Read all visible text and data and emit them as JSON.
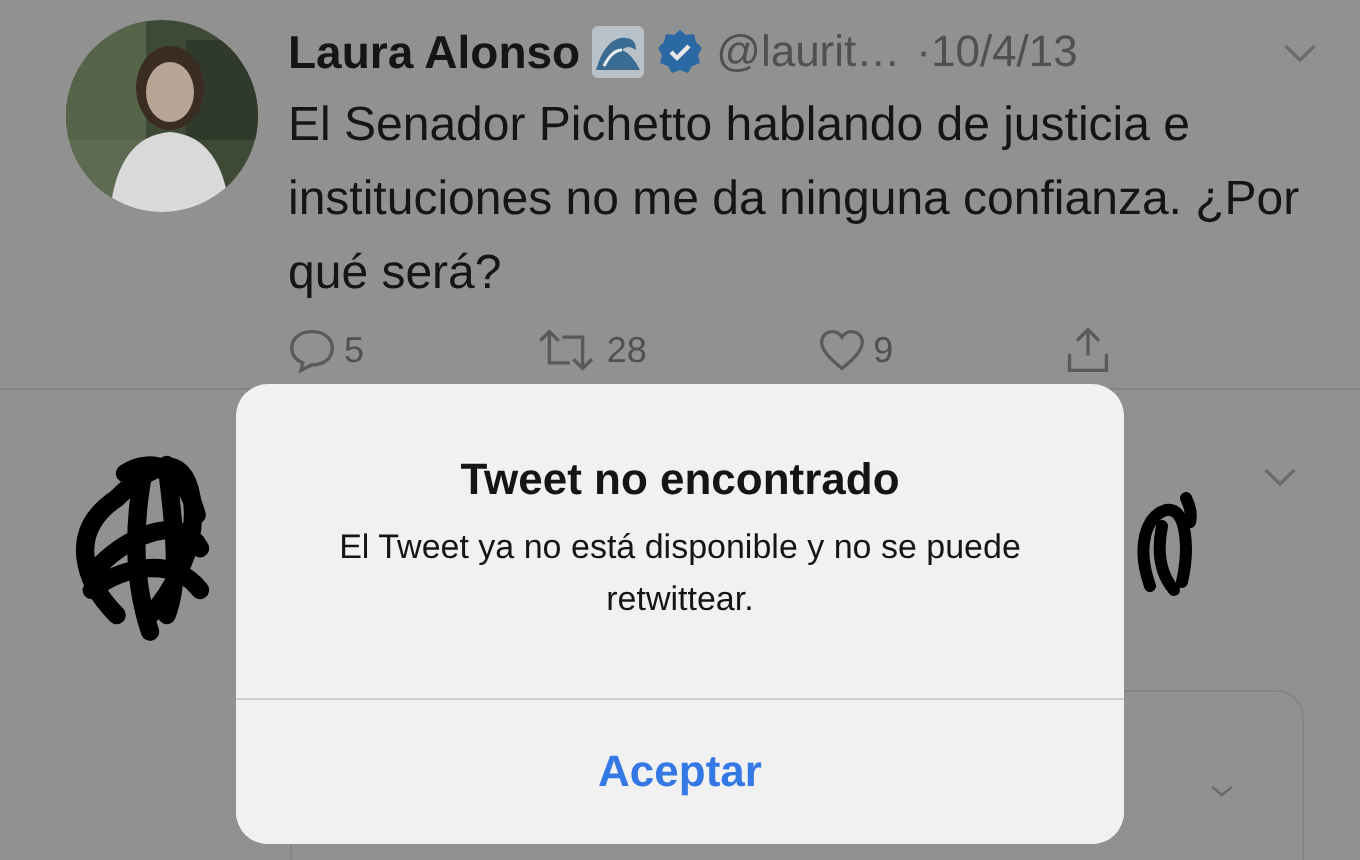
{
  "tweet": {
    "name": "Laura Alonso",
    "handle": "@laurit…",
    "time": "·10/4/13",
    "verified": true,
    "text": "El Senador Pichetto hablando de justicia e instituciones no me da ninguna confianza. ¿Por qué será?",
    "replies": "5",
    "retweets": "28",
    "likes": "9"
  },
  "alert": {
    "title": "Tweet no encontrado",
    "message": "El Tweet ya no está disponible y no se puede retwittear.",
    "button": "Aceptar"
  }
}
